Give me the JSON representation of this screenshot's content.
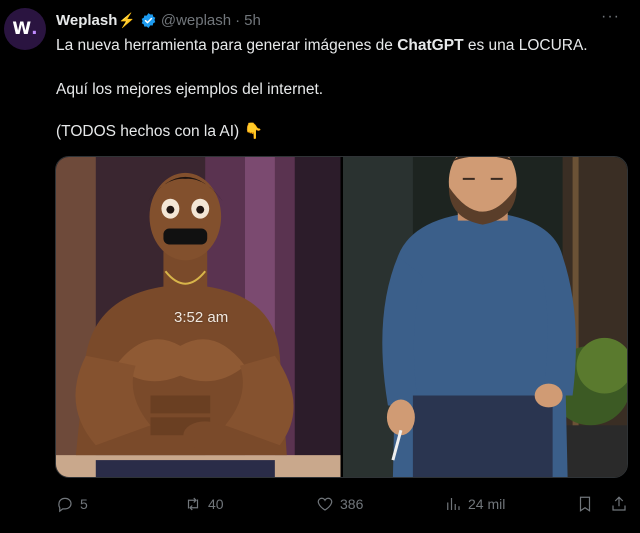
{
  "tweet": {
    "avatar_text": "W",
    "avatar_dot": ".",
    "display_name": "Weplash",
    "name_emoji": "⚡",
    "handle": "@weplash",
    "separator": "·",
    "time": "5h",
    "more_icon": "···",
    "text_line1_pre": "La nueva herramienta para generar imágenes de ",
    "text_line1_bold": "ChatGPT",
    "text_line1_post": " es una LOCURA.",
    "text_line2": "Aquí los mejores ejemplos del internet.",
    "text_line3": "(TODOS hechos con la AI) ",
    "text_line3_emoji": "👇"
  },
  "media": {
    "left_image_overlay_text": "3:52 am"
  },
  "actions": {
    "replies": "5",
    "retweets": "40",
    "likes": "386",
    "views": "24 mil"
  },
  "colors": {
    "background": "#000000",
    "text": "#e7e9ea",
    "muted": "#71767b",
    "verified_blue": "#1d9bf0",
    "bolt_yellow": "#f7c600"
  }
}
